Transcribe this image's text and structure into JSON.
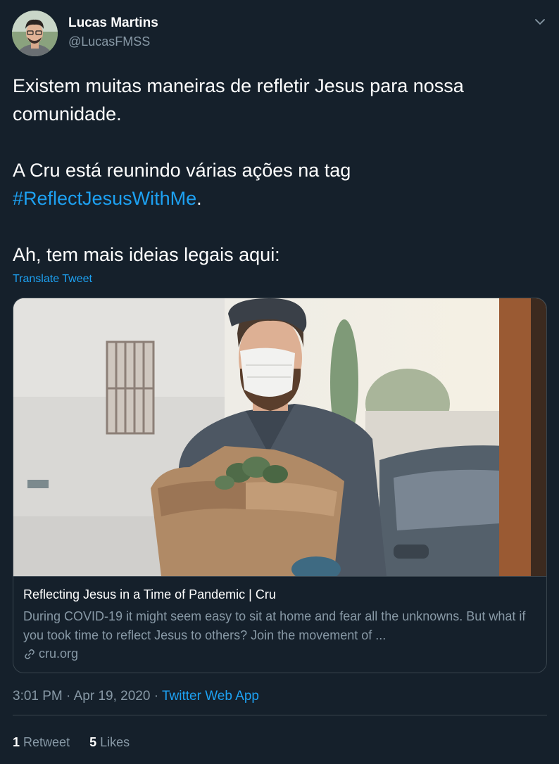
{
  "user": {
    "display_name": "Lucas Martins",
    "handle": "@LucasFMSS"
  },
  "tweet": {
    "line1": "Existem muitas maneiras de refletir Jesus para nossa comunidade.",
    "line2_prefix": "A Cru está reunindo várias ações na tag ",
    "hashtag": "#ReflectJesusWithMe",
    "line2_suffix": ".",
    "line3": "Ah, tem mais ideias legais aqui:",
    "translate_label": "Translate Tweet"
  },
  "card": {
    "title": "Reflecting Jesus in a Time of Pandemic | Cru",
    "description": "During COVID-19 it might seem easy to sit at home and fear all the unknowns. But what if you took time to reflect Jesus to others? Join the movement of ...",
    "domain": "cru.org"
  },
  "meta": {
    "time": "3:01 PM",
    "separator": " · ",
    "date": "Apr 19, 2020",
    "source": "Twitter Web App"
  },
  "stats": {
    "retweets_count": "1",
    "retweets_label": "Retweet",
    "likes_count": "5",
    "likes_label": "Likes"
  },
  "icons": {
    "caret": "chevron-down-icon",
    "link": "link-icon"
  },
  "colors": {
    "background": "#15202b",
    "accent": "#1da1f2",
    "secondary_text": "#8899a6",
    "border": "#38444d"
  }
}
